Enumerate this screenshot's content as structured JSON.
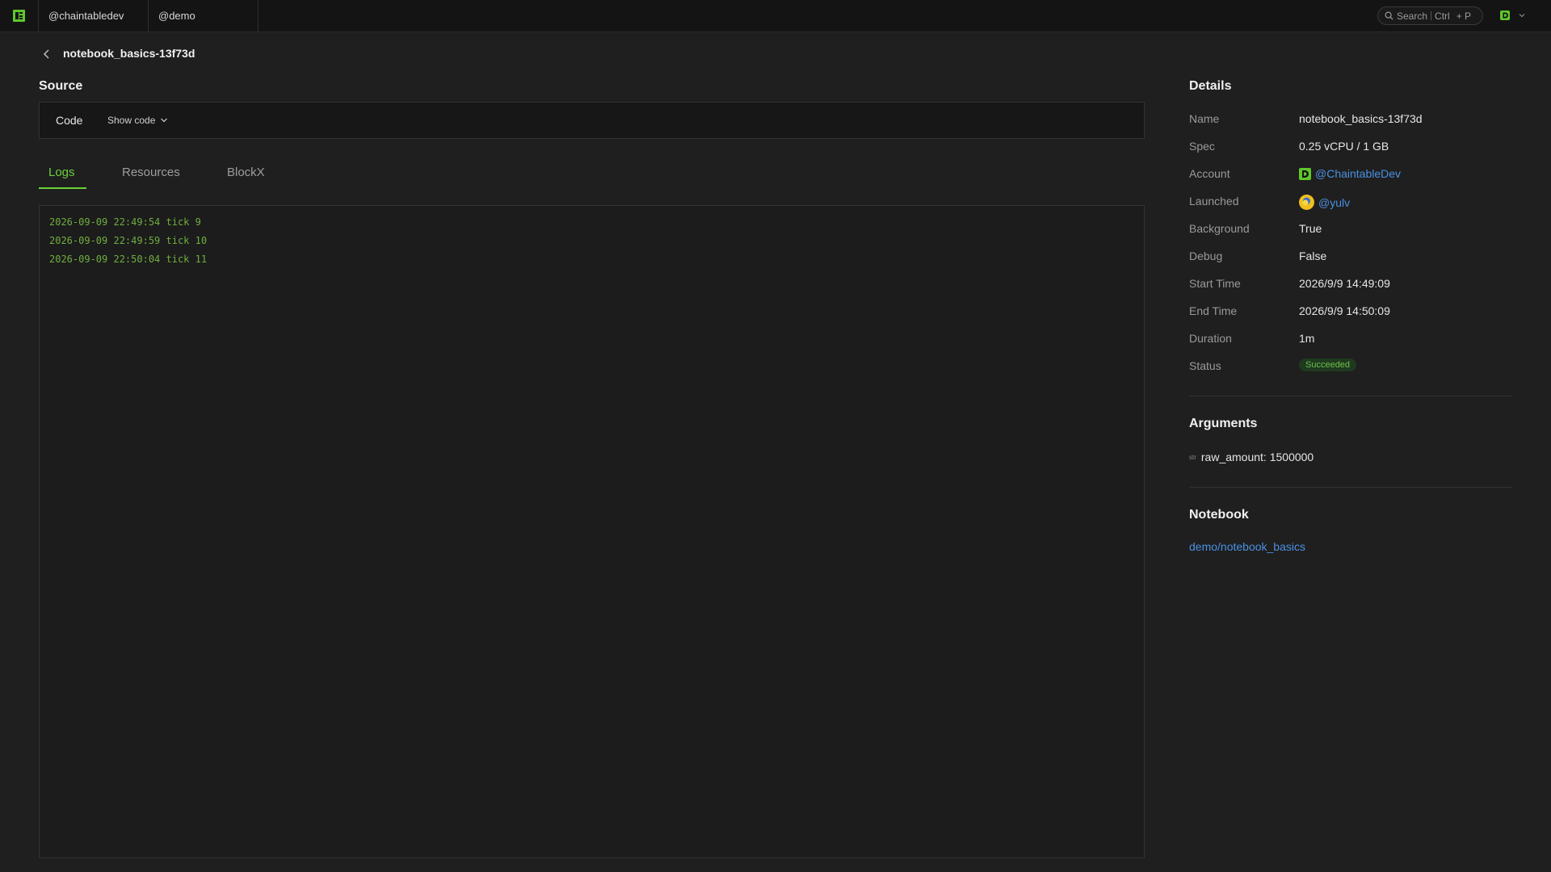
{
  "topbar": {
    "workspaces": [
      "@chaintabledev",
      "@demo"
    ],
    "search": {
      "label": "Search",
      "shortcut": "Ctrl",
      "shortcut_key": "+ P"
    }
  },
  "page": {
    "title": "notebook_basics-13f73d"
  },
  "source": {
    "title": "Source",
    "code_label": "Code",
    "show_code": "Show code"
  },
  "tabs": [
    {
      "label": "Logs",
      "active": true
    },
    {
      "label": "Resources",
      "active": false
    },
    {
      "label": "BlockX",
      "active": false
    }
  ],
  "logs": [
    "2026-09-09 22:49:54 tick 9",
    "2026-09-09 22:49:59 tick 10",
    "2026-09-09 22:50:04 tick 11"
  ],
  "details": {
    "title": "Details",
    "rows": [
      {
        "label": "Name",
        "value": "notebook_basics-13f73d"
      },
      {
        "label": "Spec",
        "value": "0.25 vCPU / 1 GB"
      },
      {
        "label": "Account",
        "value": "@ChaintableDev"
      },
      {
        "label": "Launched",
        "value": "@yulv"
      },
      {
        "label": "Background",
        "value": "True"
      },
      {
        "label": "Debug",
        "value": "False"
      },
      {
        "label": "Start Time",
        "value": "2026/9/9 14:49:09"
      },
      {
        "label": "End Time",
        "value": "2026/9/9 14:50:09"
      },
      {
        "label": "Duration",
        "value": "1m"
      },
      {
        "label": "Status",
        "value": "Succeeded"
      }
    ]
  },
  "arguments": {
    "title": "Arguments",
    "type_tag": "str",
    "text": "raw_amount: 1500000"
  },
  "notebook": {
    "title": "Notebook",
    "link": "demo/notebook_basics"
  },
  "colors": {
    "accent": "#6bd13a",
    "link": "#4a90e2",
    "log_text": "#6fae3f",
    "background": "#1f1f1f"
  }
}
